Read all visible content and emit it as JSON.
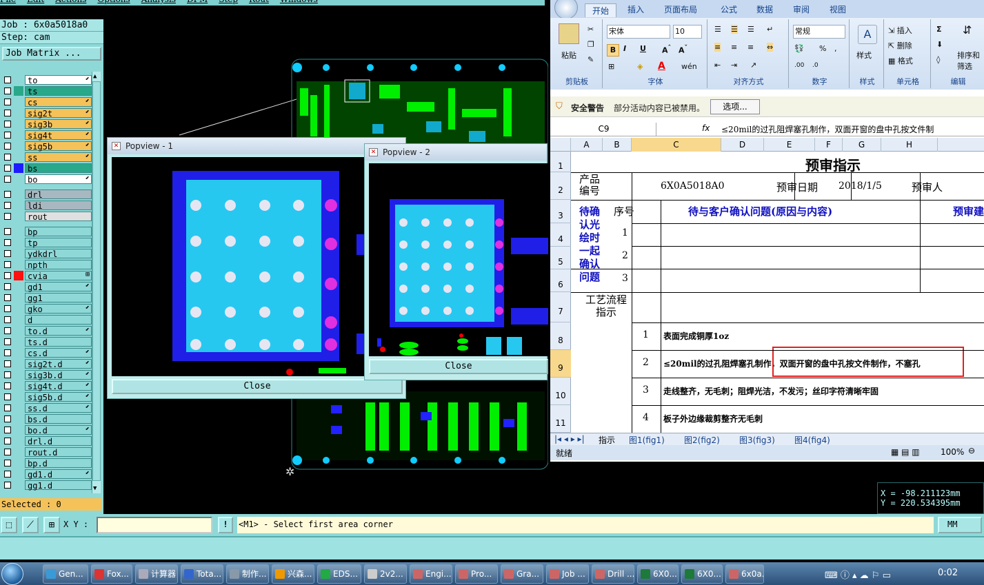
{
  "genesis": {
    "menu": [
      "File",
      "Edit",
      "Actions",
      "Options",
      "Analysis",
      "DFM",
      "Step",
      "Rout",
      "Windows"
    ],
    "job_label": "Job : 6x0a5018a0",
    "step_label": "Step: cam",
    "job_matrix_button": "Job Matrix ...",
    "layers": [
      {
        "name": "to",
        "color": "#ffffff",
        "pen": "⬋",
        "sel": ""
      },
      {
        "name": "ts",
        "color": "#2aa88a",
        "pen": "",
        "sel": "#2aa88a"
      },
      {
        "name": "cs",
        "color": "#f5c25a",
        "pen": "⬋",
        "sel": ""
      },
      {
        "name": "sig2t",
        "color": "#f5c25a",
        "pen": "⬋",
        "sel": ""
      },
      {
        "name": "sig3b",
        "color": "#f5c25a",
        "pen": "⬋",
        "sel": ""
      },
      {
        "name": "sig4t",
        "color": "#f5c25a",
        "pen": "⬋",
        "sel": ""
      },
      {
        "name": "sig5b",
        "color": "#f5c25a",
        "pen": "⬋",
        "sel": ""
      },
      {
        "name": "ss",
        "color": "#f5c25a",
        "pen": "⬋",
        "sel": ""
      },
      {
        "name": "bs",
        "color": "#2aa88a",
        "pen": "",
        "sel": "#1c1cff"
      },
      {
        "name": "bo",
        "color": "#ffffff",
        "pen": "⬋",
        "sel": ""
      },
      {
        "sep": true
      },
      {
        "name": "drl",
        "color": "#a8b8c0",
        "pen": "",
        "sel": ""
      },
      {
        "name": "ldi",
        "color": "#a8b8c0",
        "pen": "",
        "sel": ""
      },
      {
        "name": "rout",
        "color": "#e0e0e0",
        "pen": "",
        "sel": ""
      },
      {
        "sep": true
      },
      {
        "name": "bp",
        "color": "#8fd8d8",
        "pen": "",
        "sel": ""
      },
      {
        "name": "tp",
        "color": "#8fd8d8",
        "pen": "",
        "sel": ""
      },
      {
        "name": "ydkdrl",
        "color": "#8fd8d8",
        "pen": "",
        "sel": ""
      },
      {
        "name": "npth",
        "color": "#8fd8d8",
        "pen": "",
        "sel": ""
      },
      {
        "name": "cvia",
        "color": "#8fd8d8",
        "pen": "⊞",
        "sel": "#ff1010"
      },
      {
        "name": "gd1",
        "color": "#8fd8d8",
        "pen": "⬋",
        "sel": ""
      },
      {
        "name": "gg1",
        "color": "#8fd8d8",
        "pen": "",
        "sel": ""
      },
      {
        "name": "gko",
        "color": "#8fd8d8",
        "pen": "⬋",
        "sel": ""
      },
      {
        "name": "d",
        "color": "#8fd8d8",
        "pen": "",
        "sel": ""
      },
      {
        "name": "to.d",
        "color": "#8fd8d8",
        "pen": "⬋",
        "sel": ""
      },
      {
        "name": "ts.d",
        "color": "#8fd8d8",
        "pen": "",
        "sel": ""
      },
      {
        "name": "cs.d",
        "color": "#8fd8d8",
        "pen": "⬋",
        "sel": ""
      },
      {
        "name": "sig2t.d",
        "color": "#8fd8d8",
        "pen": "⬋",
        "sel": ""
      },
      {
        "name": "sig3b.d",
        "color": "#8fd8d8",
        "pen": "⬋",
        "sel": ""
      },
      {
        "name": "sig4t.d",
        "color": "#8fd8d8",
        "pen": "⬋",
        "sel": ""
      },
      {
        "name": "sig5b.d",
        "color": "#8fd8d8",
        "pen": "⬋",
        "sel": ""
      },
      {
        "name": "ss.d",
        "color": "#8fd8d8",
        "pen": "⬋",
        "sel": ""
      },
      {
        "name": "bs.d",
        "color": "#8fd8d8",
        "pen": "",
        "sel": ""
      },
      {
        "name": "bo.d",
        "color": "#8fd8d8",
        "pen": "⬋",
        "sel": ""
      },
      {
        "name": "drl.d",
        "color": "#8fd8d8",
        "pen": "",
        "sel": ""
      },
      {
        "name": "rout.d",
        "color": "#8fd8d8",
        "pen": "",
        "sel": ""
      },
      {
        "name": "bp.d",
        "color": "#8fd8d8",
        "pen": "",
        "sel": ""
      },
      {
        "name": "gd1.d",
        "color": "#8fd8d8",
        "pen": "⬋",
        "sel": ""
      },
      {
        "name": "gg1.d",
        "color": "#8fd8d8",
        "pen": "",
        "sel": ""
      }
    ],
    "selected": "Selected : 0",
    "xy_label": "X Y :",
    "prompt": "<M1> - Select first area corner",
    "units": "MM",
    "coord_x": "X = -98.211123mm",
    "coord_y": "Y = 220.534395mm",
    "popview1_title": "Popview - 1",
    "popview2_title": "Popview - 2",
    "close_label": "Close"
  },
  "excel": {
    "tabs": [
      "开始",
      "插入",
      "页面布局",
      "公式",
      "数据",
      "审阅",
      "视图"
    ],
    "font_name": "宋体",
    "font_size": "10",
    "number_format": "常规",
    "groups": [
      "剪贴板",
      "字体",
      "对齐方式",
      "数字",
      "样式",
      "单元格",
      "编辑"
    ],
    "paste": "粘贴",
    "style": "样式",
    "insert": "插入",
    "delete": "删除",
    "format": "格式",
    "sort_filter_1": "排序和",
    "sort_filter_2": "筛选",
    "security_warning": "安全警告",
    "warning_text": "部分活动内容已被禁用。",
    "options_button": "选项...",
    "cell_ref": "C9",
    "formula": "≤20mil的过孔阻焊塞孔制作，双面开窗的盘中孔按文件制",
    "columns": [
      "A",
      "B",
      "C",
      "D",
      "E",
      "F",
      "G",
      "H"
    ],
    "rows": [
      "1",
      "2",
      "3",
      "4",
      "5",
      "6",
      "7",
      "8",
      "9",
      "10",
      "11"
    ],
    "title": "预审指示",
    "product_no": "产品编号",
    "product_no_value": "6X0A5018A0",
    "review_date_label": "预审日期",
    "review_date": "2018/1/5",
    "reviewer": "预审人",
    "confirm_label": "待确认光绘时一起确认问题",
    "seq": "序号",
    "question_header": "待与客户确认问题(原因与内容)",
    "suggest_header": "预审建",
    "q_rows": [
      "1",
      "2",
      "3"
    ],
    "process_label": "工艺流程指示",
    "process_items": [
      {
        "no": "1",
        "text": "表面完成铜厚1oz"
      },
      {
        "no": "2",
        "text": "≤20mil的过孔阻焊塞孔制作，双面开窗的盘中孔按文件制作，不塞孔"
      },
      {
        "no": "3",
        "text": "走线整齐，无毛刺；阻焊光洁，不发污；丝印字符清晰牢固"
      },
      {
        "no": "4",
        "text": "板子外边缘裁剪整齐无毛刺"
      }
    ],
    "sheet_tabs": [
      "指示",
      "图1(fig1)",
      "图2(fig2)",
      "图3(fig3)",
      "图4(fig4)"
    ],
    "status_ready": "就绪",
    "zoom": "100%"
  },
  "taskbar": {
    "items": [
      {
        "label": "Gen...",
        "color": "#3a9ad6"
      },
      {
        "label": "Fox...",
        "color": "#d33"
      },
      {
        "label": "计算器",
        "color": "#aab"
      },
      {
        "label": "Tota...",
        "color": "#36c"
      },
      {
        "label": "制作...",
        "color": "#89a"
      },
      {
        "label": "兴森...",
        "color": "#e90"
      },
      {
        "label": "EDS...",
        "color": "#2a4"
      },
      {
        "label": "2v2...",
        "color": "#ccc"
      },
      {
        "label": "Engi...",
        "color": "#c66"
      },
      {
        "label": "Pro...",
        "color": "#c66"
      },
      {
        "label": "Gra...",
        "color": "#c66"
      },
      {
        "label": "Job ...",
        "color": "#c66"
      },
      {
        "label": "Drill ...",
        "color": "#c66"
      },
      {
        "label": "6X0...",
        "color": "#1d7a3a"
      },
      {
        "label": "6X0...",
        "color": "#1d7a3a"
      },
      {
        "label": "6x0a...",
        "color": "#c66"
      }
    ],
    "time": "0:02"
  }
}
